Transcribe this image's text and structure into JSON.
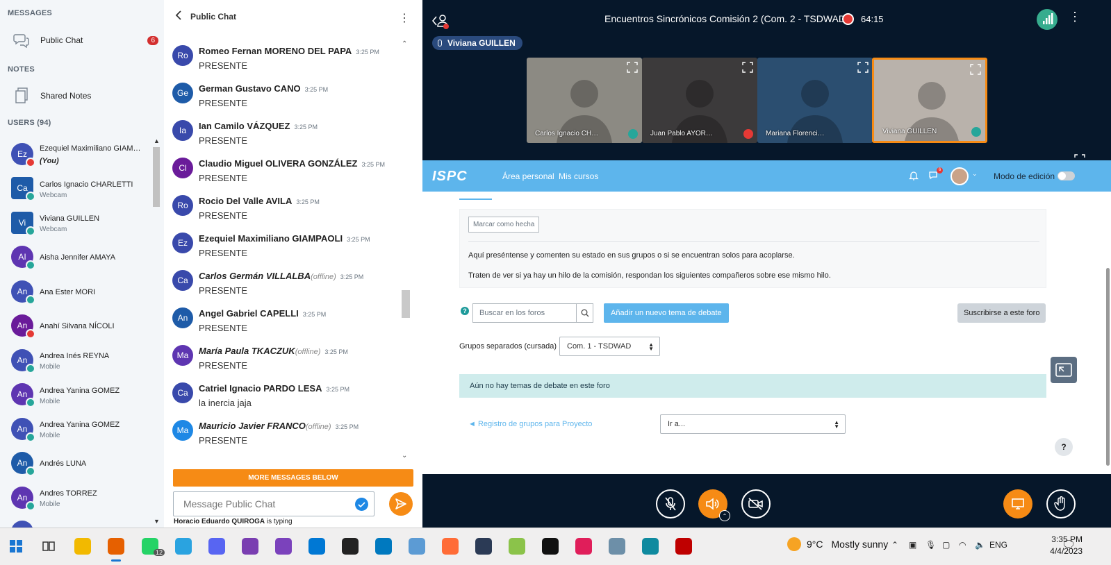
{
  "sidebar": {
    "messages_title": "MESSAGES",
    "public_chat_label": "Public Chat",
    "public_chat_badge": "6",
    "notes_title": "NOTES",
    "shared_notes_label": "Shared Notes",
    "users_title": "USERS (94)",
    "users": [
      {
        "initials": "Ez",
        "name": "Ezequiel Maximiliano GIAM…",
        "you": "(You)",
        "sub": "",
        "color": "#3F51B5",
        "status": "#E53935"
      },
      {
        "initials": "Ca",
        "name": "Carlos Ignacio CHARLETTI",
        "you": "",
        "sub": "Webcam",
        "color": "#1E5BA8",
        "status": "#26A69A"
      },
      {
        "initials": "Vi",
        "name": "Viviana GUILLEN",
        "you": "",
        "sub": "Webcam",
        "color": "#1E5BA8",
        "status": "#26A69A"
      },
      {
        "initials": "AI",
        "name": "Aisha Jennifer AMAYA",
        "you": "",
        "sub": "",
        "color": "#5E35B1",
        "status": "#26A69A"
      },
      {
        "initials": "An",
        "name": "Ana Ester MORI",
        "you": "",
        "sub": "",
        "color": "#3F51B5",
        "status": "#26A69A"
      },
      {
        "initials": "An",
        "name": "Anahí Silvana NÍCOLI",
        "you": "",
        "sub": "",
        "color": "#6A1B9A",
        "status": "#E53935"
      },
      {
        "initials": "An",
        "name": "Andrea Inés REYNA",
        "you": "",
        "sub": "Mobile",
        "color": "#3F51B5",
        "status": "#26A69A"
      },
      {
        "initials": "An",
        "name": "Andrea Yanina GOMEZ",
        "you": "",
        "sub": "Mobile",
        "color": "#5E35B1",
        "status": "#26A69A"
      },
      {
        "initials": "An",
        "name": "Andrea Yanina GOMEZ",
        "you": "",
        "sub": "Mobile",
        "color": "#3F51B5",
        "status": "#26A69A"
      },
      {
        "initials": "An",
        "name": "Andrés LUNA",
        "you": "",
        "sub": "",
        "color": "#1E5BA8",
        "status": "#26A69A"
      },
      {
        "initials": "An",
        "name": "Andres TORREZ",
        "you": "",
        "sub": "Mobile",
        "color": "#5E35B1",
        "status": "#26A69A"
      },
      {
        "initials": "An",
        "name": "Angel Gabriel CAPELLI",
        "you": "",
        "sub": "",
        "color": "#3F51B5",
        "status": "#26A69A"
      }
    ]
  },
  "chat": {
    "title": "Public Chat",
    "messages": [
      {
        "initials": "Ro",
        "name": "Romeo Fernan MORENO DEL PAPA",
        "offline": "",
        "time": "3:25 PM",
        "text": "PRESENTE",
        "color": "#3949AB"
      },
      {
        "initials": "Ge",
        "name": "German Gustavo CANO",
        "offline": "",
        "time": "3:25 PM",
        "text": "PRESENTE",
        "color": "#1E5BA8"
      },
      {
        "initials": "Ia",
        "name": "Ian Camilo VÁZQUEZ",
        "offline": "",
        "time": "3:25 PM",
        "text": "PRESENTE",
        "color": "#3949AB"
      },
      {
        "initials": "Cl",
        "name": "Claudio Miguel OLIVERA GONZÁLEZ",
        "offline": "",
        "time": "3:25 PM",
        "text": "PRESENTE",
        "color": "#6A1B9A"
      },
      {
        "initials": "Ro",
        "name": "Rocio Del Valle AVILA",
        "offline": "",
        "time": "3:25 PM",
        "text": "PRESENTE",
        "color": "#3949AB"
      },
      {
        "initials": "Ez",
        "name": "Ezequiel Maximiliano GIAMPAOLI",
        "offline": "",
        "time": "3:25 PM",
        "text": "PRESENTE",
        "color": "#3949AB"
      },
      {
        "initials": "Ca",
        "name": "Carlos Germán VILLALBA",
        "offline": "(offline)",
        "time": "3:25 PM",
        "text": "PRESENTE",
        "color": "#3949AB"
      },
      {
        "initials": "An",
        "name": "Angel Gabriel CAPELLI",
        "offline": "",
        "time": "3:25 PM",
        "text": "PRESENTE",
        "color": "#1E5BA8"
      },
      {
        "initials": "Ma",
        "name": "María Paula TKACZUK",
        "offline": "(offline)",
        "time": "3:25 PM",
        "text": "PRESENTE",
        "color": "#5E35B1"
      },
      {
        "initials": "Ca",
        "name": "Catriel Ignacio PARDO LESA",
        "offline": "",
        "time": "3:25 PM",
        "text": "la inercia jaja",
        "color": "#3949AB"
      },
      {
        "initials": "Ma",
        "name": "Mauricio Javier FRANCO",
        "offline": "(offline)",
        "time": "3:25 PM",
        "text": "PRESENTE",
        "color": "#1E88E5"
      }
    ],
    "more_below": "MORE MESSAGES BELOW",
    "input_placeholder": "Message Public Chat",
    "typing_user": "Horacio Eduardo QUIROGA",
    "typing_suffix": " is typing"
  },
  "meeting": {
    "title": "Encuentros Sincrónicos Comisión 2 (Com. 2 - TSDWAD)",
    "rec_time": "64:15",
    "talker": "Viviana GUILLEN",
    "tiles": [
      {
        "name": "Carlos Ignacio CH…",
        "bg": "#8C8A83",
        "audio": "#26A69A"
      },
      {
        "name": "Juan Pablo AYOR…",
        "bg": "#3C3A3B",
        "audio": "#E53935"
      },
      {
        "name": "Mariana Florenci…",
        "bg": "#2B4E70",
        "audio": ""
      },
      {
        "name": "Viviana GUILLEN",
        "bg": "#B9B2AB",
        "audio": "#26A69A"
      }
    ],
    "accent": "#F68B15"
  },
  "shared_page": {
    "logo": "ISPC",
    "nav": [
      "Área personal",
      "Mis cursos"
    ],
    "chat_badge": "6",
    "edit_mode": "Modo de edición",
    "mark_done": "Marcar como hecha",
    "para1": "Aquí preséntense y comenten su estado en sus grupos o si se encuentran solos para acoplarse.",
    "para2": "Traten de ver si ya hay un hilo de la comisión, respondan los siguientes compañeros  sobre ese mismo hilo.",
    "search_placeholder": "Buscar en los foros",
    "new_topic": "Añadir un nuevo tema de debate",
    "subscribe": "Suscribirse a este foro",
    "groups_label": "Grupos separados (cursada)",
    "groups_value": "Com. 1 - TSDWAD",
    "no_topics": "Aún no hay temas de debate en este foro",
    "reg_link": "◄ Registro de grupos para Proyecto",
    "goto_value": "Ir a...",
    "help": "?"
  },
  "taskbar": {
    "whatsapp_badge": "12",
    "weather_temp": "9°C",
    "weather_cond": "Mostly sunny",
    "lang": "ENG",
    "time": "3:35 PM",
    "date": "4/4/2023"
  }
}
